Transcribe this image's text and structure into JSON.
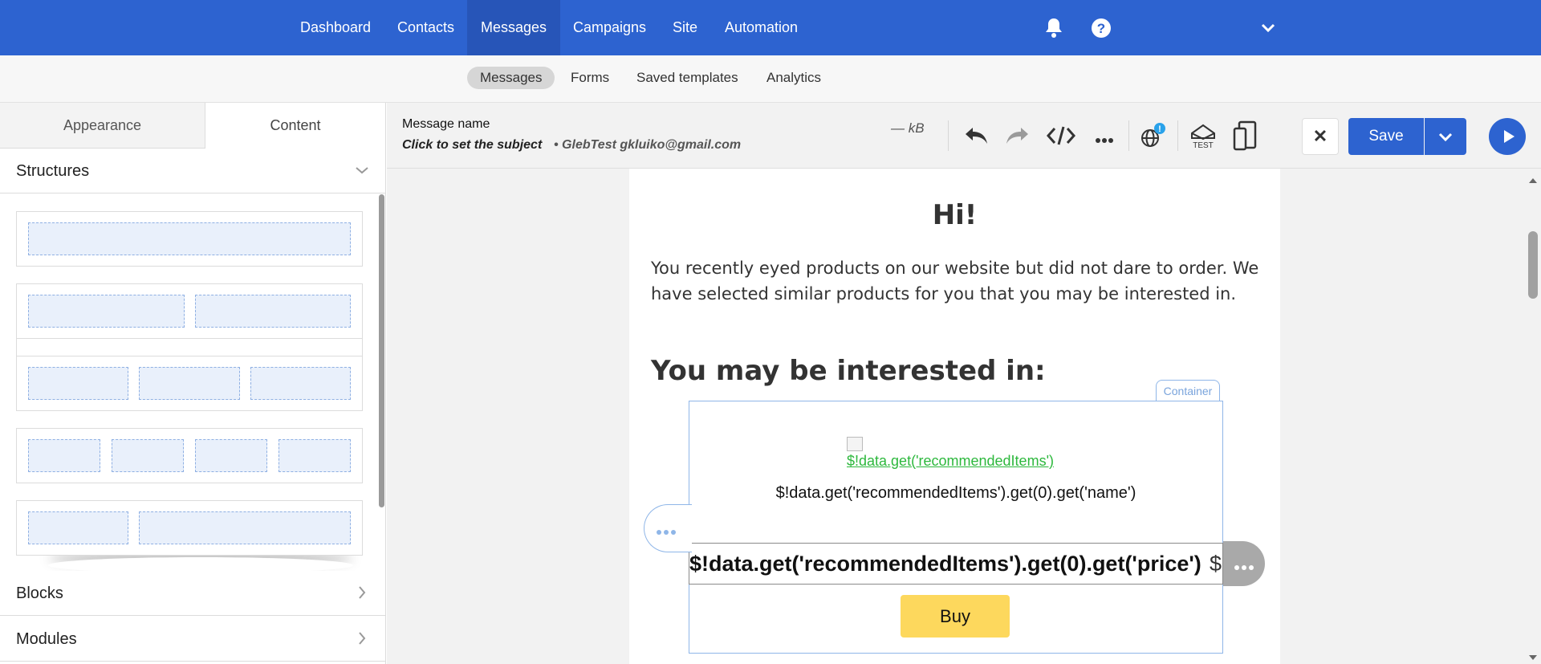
{
  "topnav": {
    "items": [
      "Dashboard",
      "Contacts",
      "Messages",
      "Campaigns",
      "Site",
      "Automation"
    ],
    "active": "Messages"
  },
  "subnav": {
    "items": [
      "Messages",
      "Forms",
      "Saved templates",
      "Analytics"
    ],
    "active": "Messages"
  },
  "leftpanel": {
    "tabs": [
      "Appearance",
      "Content"
    ],
    "active_tab": "Content",
    "sections": {
      "structures": "Structures",
      "blocks": "Blocks",
      "modules": "Modules"
    }
  },
  "toolbar": {
    "message_name": "Message name",
    "subject_placeholder": "Click to set the subject",
    "sender": "• GlebTest gkluiko@gmail.com",
    "size": "— kB",
    "test_label": "TEST",
    "globe_badge": "!",
    "close_label": "✕",
    "save_label": "Save"
  },
  "email": {
    "greeting": "Hi!",
    "intro": "You recently eyed products on our website but did not dare to order. We have selected similar products for you that you may be interested in.",
    "section_title": "You may be interested in:",
    "container_tag": "Container",
    "image_alt": "$!data.get('recommendedItems')",
    "item_name": "$!data.get('recommendedItems').get(0).get('name')",
    "item_price": "$!data.get('recommendedItems').get(0).get('price')",
    "price_suffix": "$",
    "buy_label": "Buy"
  },
  "colors": {
    "brand": "#2d63d0",
    "buy_button": "#fdd85d",
    "link": "#2db83d"
  }
}
